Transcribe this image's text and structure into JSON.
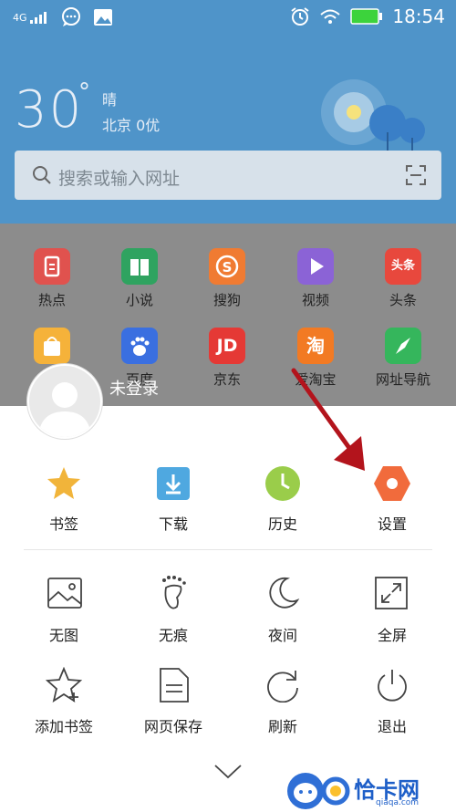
{
  "status_bar": {
    "network": "4G",
    "time": "18:54"
  },
  "weather": {
    "temperature": "30",
    "degree": "°",
    "condition": "晴",
    "location_aqi": "北京 0优"
  },
  "search": {
    "placeholder": "搜索或输入网址"
  },
  "shortcuts": [
    {
      "label": "热点",
      "color": "#e0524e"
    },
    {
      "label": "小说",
      "color": "#2fa360"
    },
    {
      "label": "搜狗",
      "color": "#f07b32"
    },
    {
      "label": "视频",
      "color": "#8b63d6"
    },
    {
      "label": "头条",
      "color": "#e8483d"
    },
    {
      "label": "",
      "color": "#f5b23a"
    },
    {
      "label": "百度",
      "color": "#3a6fe0"
    },
    {
      "label": "京东",
      "color": "#e53935"
    },
    {
      "label": "爱淘宝",
      "color": "#f27a23"
    },
    {
      "label": "网址导航",
      "color": "#35b65c"
    }
  ],
  "tile_texts": {
    "jd": "JD",
    "toutiao": "头条",
    "tao": "淘"
  },
  "account": {
    "login_label": "未登录"
  },
  "menu_row1": [
    {
      "label": "书签",
      "icon": "star-icon"
    },
    {
      "label": "下载",
      "icon": "download-icon"
    },
    {
      "label": "历史",
      "icon": "clock-icon"
    },
    {
      "label": "设置",
      "icon": "settings-icon"
    }
  ],
  "menu_row2": [
    {
      "label": "无图",
      "icon": "image-icon"
    },
    {
      "label": "无痕",
      "icon": "footprint-icon"
    },
    {
      "label": "夜间",
      "icon": "moon-icon"
    },
    {
      "label": "全屏",
      "icon": "fullscreen-icon"
    }
  ],
  "menu_row3": [
    {
      "label": "添加书签",
      "icon": "star-add-icon"
    },
    {
      "label": "网页保存",
      "icon": "save-page-icon"
    },
    {
      "label": "刷新",
      "icon": "refresh-icon"
    },
    {
      "label": "退出",
      "icon": "power-icon"
    }
  ],
  "watermark": {
    "brand": "恰卡网",
    "domain": "qiaqa.com"
  },
  "colors": {
    "header_blue": "#4f94c9",
    "overlay_gray": "#8c8c8c",
    "annotation_arrow": "#b3141c",
    "settings_orange": "#f16b3c"
  }
}
